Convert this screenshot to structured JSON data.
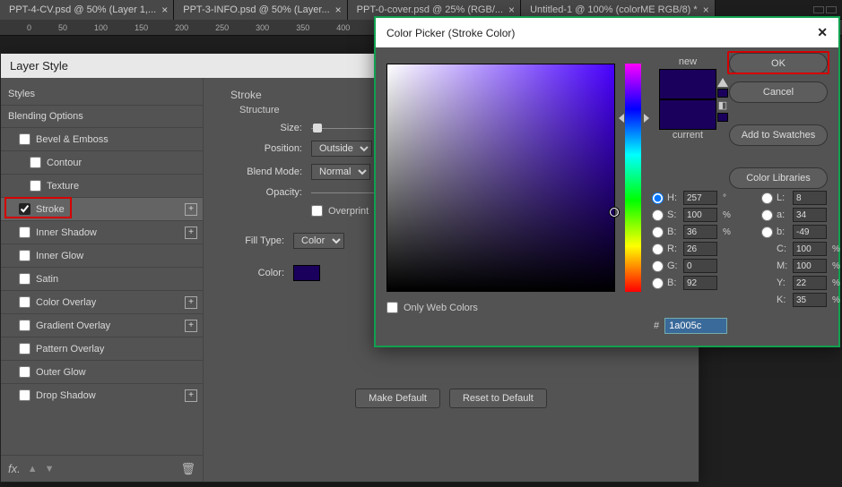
{
  "tabs": [
    {
      "label": "PPT-4-CV.psd @ 50% (Layer 1,..."
    },
    {
      "label": "PPT-3-INFO.psd @ 50% (Layer..."
    },
    {
      "label": "PPT-0-cover.psd @ 25% (RGB/..."
    },
    {
      "label": "Untitled-1 @ 100% (colorME  RGB/8) *"
    }
  ],
  "ruler_marks": [
    "0",
    "50",
    "100",
    "150",
    "200",
    "250",
    "300",
    "350",
    "400"
  ],
  "layerstyle": {
    "title": "Layer Style",
    "styles_head": "Styles",
    "blending": "Blending Options",
    "bevel": "Bevel & Emboss",
    "contour": "Contour",
    "texture": "Texture",
    "stroke": "Stroke",
    "inner_shadow": "Inner Shadow",
    "inner_glow": "Inner Glow",
    "satin": "Satin",
    "color_overlay": "Color Overlay",
    "gradient_overlay": "Gradient Overlay",
    "pattern_overlay": "Pattern Overlay",
    "outer_glow": "Outer Glow",
    "drop_shadow": "Drop Shadow",
    "main": {
      "section": "Stroke",
      "structure": "Structure",
      "size": "Size:",
      "position": "Position:",
      "position_val": "Outside",
      "blend": "Blend Mode:",
      "blend_val": "Normal",
      "opacity": "Opacity:",
      "overprint": "Overprint",
      "filltype": "Fill Type:",
      "filltype_val": "Color",
      "color": "Color:",
      "make_default": "Make Default",
      "reset_default": "Reset to Default"
    }
  },
  "picker": {
    "title": "Color Picker (Stroke Color)",
    "new": "new",
    "current": "current",
    "ok": "OK",
    "cancel": "Cancel",
    "add_swatches": "Add to Swatches",
    "libraries": "Color Libraries",
    "fields": {
      "H": {
        "label": "H:",
        "val": "257",
        "unit": "°"
      },
      "S": {
        "label": "S:",
        "val": "100",
        "unit": "%"
      },
      "Bv": {
        "label": "B:",
        "val": "36",
        "unit": "%"
      },
      "R": {
        "label": "R:",
        "val": "26",
        "unit": ""
      },
      "G": {
        "label": "G:",
        "val": "0",
        "unit": ""
      },
      "Bc": {
        "label": "B:",
        "val": "92",
        "unit": ""
      },
      "L": {
        "label": "L:",
        "val": "8",
        "unit": ""
      },
      "a": {
        "label": "a:",
        "val": "34",
        "unit": ""
      },
      "b": {
        "label": "b:",
        "val": "-49",
        "unit": ""
      },
      "C": {
        "label": "C:",
        "val": "100",
        "unit": "%"
      },
      "M": {
        "label": "M:",
        "val": "100",
        "unit": "%"
      },
      "Y": {
        "label": "Y:",
        "val": "22",
        "unit": "%"
      },
      "K": {
        "label": "K:",
        "val": "35",
        "unit": "%"
      }
    },
    "hex_prefix": "#",
    "hex": "1a005c",
    "webonly": "Only Web Colors"
  }
}
